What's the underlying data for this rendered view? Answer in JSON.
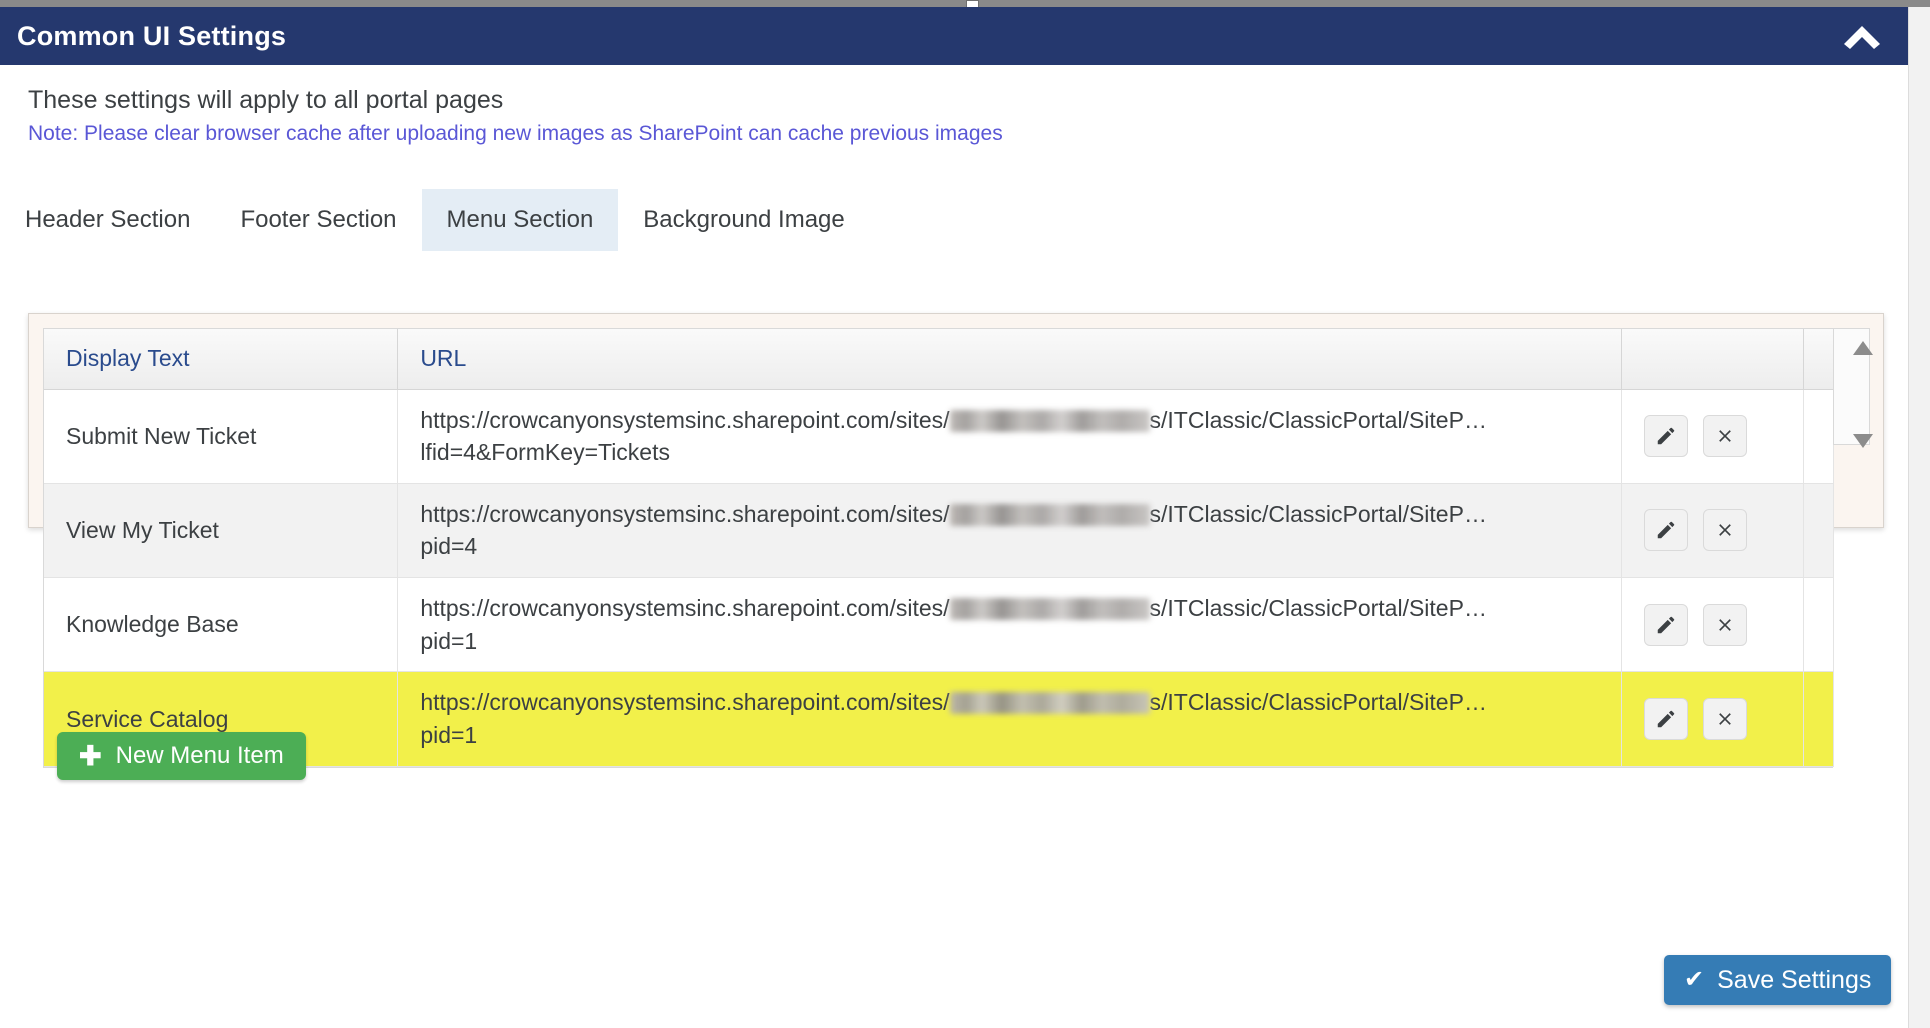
{
  "window": {
    "title": "Common UI Settings",
    "collapse_icon": "chevron-up-icon"
  },
  "intro": {
    "description": "These settings will apply to all portal pages",
    "note": "Note: Please clear browser cache after uploading new images as SharePoint can cache previous images"
  },
  "tabs": {
    "items": [
      {
        "label": "Header Section",
        "active": false
      },
      {
        "label": "Footer Section",
        "active": false
      },
      {
        "label": "Menu Section",
        "active": true
      },
      {
        "label": "Background Image",
        "active": false
      }
    ]
  },
  "table": {
    "columns": [
      "Display Text",
      "URL"
    ],
    "rows": [
      {
        "display_text": "Submit New Ticket",
        "url_prefix": "https://crowcanyonsystemsinc.sharepoint.com/sites/",
        "url_suffix": "s/ITClassic/ClassicPortal/SiteP…",
        "url_line2": "lfid=4&FormKey=Tickets",
        "edit_label": "pencil-icon",
        "delete_label": "close-icon",
        "highlight": false
      },
      {
        "display_text": "View My Ticket",
        "url_prefix": "https://crowcanyonsystemsinc.sharepoint.com/sites/",
        "url_suffix": "s/ITClassic/ClassicPortal/SiteP…",
        "url_line2": "pid=4",
        "edit_label": "pencil-icon",
        "delete_label": "close-icon",
        "highlight": false
      },
      {
        "display_text": "Knowledge Base",
        "url_prefix": "https://crowcanyonsystemsinc.sharepoint.com/sites/",
        "url_suffix": "s/ITClassic/ClassicPortal/SiteP…",
        "url_line2": "pid=1",
        "edit_label": "pencil-icon",
        "delete_label": "close-icon",
        "highlight": false
      },
      {
        "display_text": "Service Catalog",
        "url_prefix": "https://crowcanyonsystemsinc.sharepoint.com/sites/",
        "url_suffix": "s/ITClassic/ClassicPortal/SiteP…",
        "url_line2": "pid=1",
        "edit_label": "pencil-icon",
        "delete_label": "close-icon",
        "highlight": true
      }
    ],
    "scroll_up_icon": "triangle-up-icon",
    "scroll_down_icon": "triangle-down-icon"
  },
  "buttons": {
    "new_menu_item": "New Menu Item",
    "new_menu_item_icon": "plus-icon",
    "save_settings": "Save Settings",
    "save_settings_icon": "check-icon"
  },
  "colors": {
    "titlebar": "#25386e",
    "accent_note": "#5a57d6",
    "tab_active_bg": "#e4edf5",
    "panel_bg": "#fbf5f0",
    "header_text": "#2a4b8d",
    "row_highlight": "#f2f04a",
    "new_button": "#4cae55",
    "save_button": "#357cb5"
  }
}
